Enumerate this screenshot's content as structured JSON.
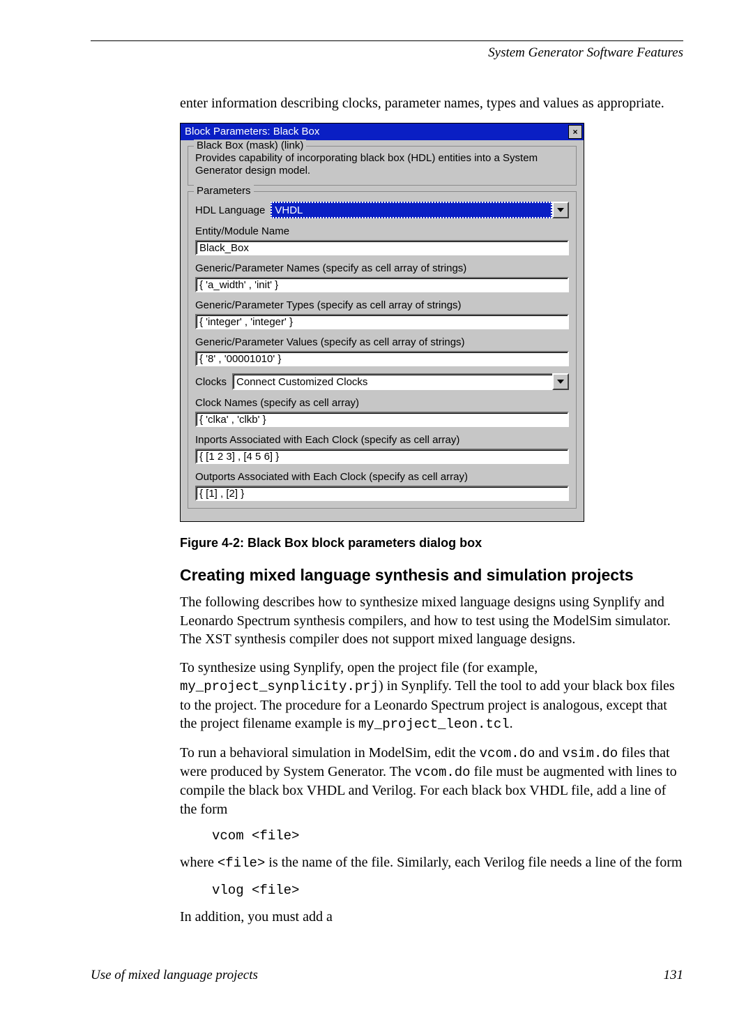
{
  "header": {
    "section": "System Generator Software Features"
  },
  "intro": "enter information describing clocks, parameter names, types and values as appropriate.",
  "dialog": {
    "title": "Block Parameters: Black Box",
    "mask_legend": "Black Box (mask) (link)",
    "mask_desc": "Provides capability of incorporating black box (HDL) entities into a System Generator design model.",
    "params_legend": "Parameters",
    "hdl_label": "HDL Language",
    "hdl_value": "VHDL",
    "entity_label": "Entity/Module Name",
    "entity_value": "Black_Box",
    "gpn_label": "Generic/Parameter Names  (specify as cell array of strings)",
    "gpn_value": "{ 'a_width' , 'init' }",
    "gpt_label": "Generic/Parameter Types  (specify as cell array of strings)",
    "gpt_value": "{ 'integer' , 'integer' }",
    "gpv_label": "Generic/Parameter Values  (specify as cell array of strings)",
    "gpv_value": "{ '8' , '00001010' }",
    "clocks_label": "Clocks",
    "clocks_value": "Connect Customized Clocks",
    "cnames_label": "Clock Names  (specify as cell array)",
    "cnames_value": "{ 'clka' , 'clkb' }",
    "inports_label": "Inports Associated with Each Clock  (specify as cell array)",
    "inports_value": "{ [1 2 3] , [4 5 6] }",
    "outports_label": "Outports Associated with Each Clock  (specify as cell array)",
    "outports_value": "{ [1] , [2] }"
  },
  "figcap": "Figure 4-2:   Black Box block parameters dialog box",
  "sec_title": "Creating mixed language synthesis and simulation projects",
  "p1": "The following describes how to synthesize mixed language designs using Synplify and Leonardo Spectrum synthesis compilers, and how to test using the ModelSim simulator. The XST synthesis compiler does not support mixed language designs.",
  "p2a": "To synthesize using Synplify, open the project file (for example, ",
  "p2_code1": "my_project_synplicity.prj",
  "p2b": ") in Synplify. Tell the tool to add your black box files to the project. The procedure for a Leonardo Spectrum project is analogous, except that the project filename example is  ",
  "p2_code2": "my_project_leon.tcl",
  "p2c": ".",
  "p3a": "To run a behavioral simulation in ModelSim, edit the ",
  "p3_code1": "vcom.do",
  "p3b": " and ",
  "p3_code2": "vsim.do",
  "p3c": " files that were produced by System Generator. The ",
  "p3_code3": "vcom.do",
  "p3d": " file must be augmented with lines to compile the black box VHDL and Verilog. For each black box VHDL file, add a line of the form",
  "cb1": "vcom <file>",
  "p4a": "where ",
  "p4_code1": "<file>",
  "p4b": " is the name of the file. Similarly, each Verilog file needs a line of the form",
  "cb2": "vlog <file>",
  "p5": "In addition, you must add a",
  "footer": {
    "left": "Use of mixed language projects",
    "right": "131"
  }
}
